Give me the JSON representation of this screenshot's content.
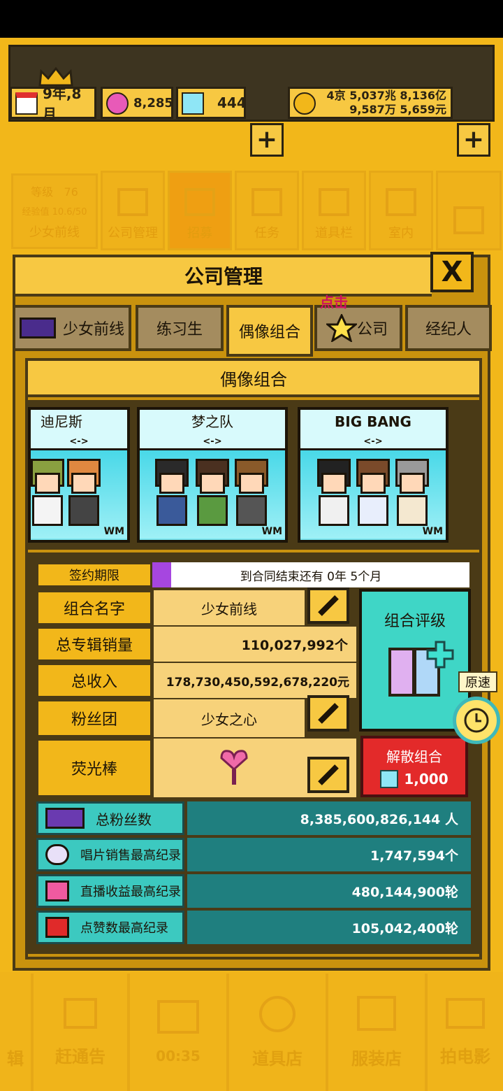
{
  "status": {
    "date": "9年,8月",
    "gems": "8,285",
    "diamonds": "444",
    "money_line1": "4京 5,037兆 8,136亿",
    "money_line2": "9,587万 5,659元",
    "plus": "+"
  },
  "profile": {
    "level_label": "等级",
    "level_value": "76",
    "exp_label": "经验值 10.6/50",
    "group_name": "少女前线"
  },
  "top_menu": [
    "公司管理",
    "招募",
    "任务",
    "道具栏",
    "室内"
  ],
  "dialog": {
    "title": "公司管理",
    "close": "X",
    "hint": "点击",
    "tabs": [
      "少女前线",
      "练习生",
      "偶像组合",
      "公司",
      "经纪人"
    ],
    "active_tab": "偶像组合",
    "section_title": "偶像组合"
  },
  "groups": [
    {
      "name": "迪尼斯",
      "arrows": "<->",
      "badge": "WM"
    },
    {
      "name": "梦之队",
      "arrows": "<->",
      "badge": "WM"
    },
    {
      "name": "BIG BANG",
      "arrows": "<->",
      "badge": "WM"
    }
  ],
  "contract": {
    "label": "签约期限",
    "text": "到合同结束还有 0年 5个月",
    "progress": 0.06
  },
  "details": {
    "name_label": "组合名字",
    "name_value": "少女前线",
    "album_label": "总专辑销量",
    "album_value": "110,027,992个",
    "income_label": "总收入",
    "income_value": "178,730,450,592,678,220元",
    "fanclub_label": "粉丝团",
    "fanclub_value": "少女之心",
    "lightstick_label": "荧光棒",
    "rating_label": "组合评级",
    "disband_label": "解散组合",
    "disband_cost": "1,000"
  },
  "stats": [
    {
      "label": "总粉丝数",
      "value": "8,385,600,826,144 人",
      "icon": "fans-icon"
    },
    {
      "label": "唱片销售最高纪录",
      "value": "1,747,594个",
      "icon": "disc-icon"
    },
    {
      "label": "直播收益最高纪录",
      "value": "480,144,900轮",
      "icon": "music-note-icon"
    },
    {
      "label": "点赞数最高纪录",
      "value": "105,042,400轮",
      "icon": "play-icon"
    }
  ],
  "speed": {
    "label": "原速"
  },
  "bottom_menu": [
    "辑",
    "赶通告",
    "00:35",
    "道具店",
    "服装店",
    "拍电影"
  ],
  "colors": {
    "gold": "#f2b71a",
    "teal": "#1f7f7f",
    "red": "#e32a2a"
  }
}
